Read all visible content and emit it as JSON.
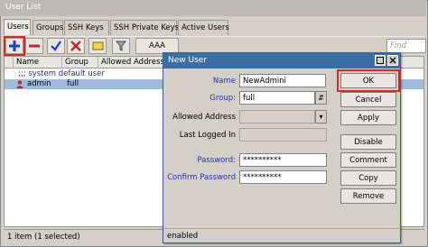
{
  "main_window": {
    "title": "User List",
    "tabs": [
      "Users",
      "Groups",
      "SSH Keys",
      "SSH Private Keys",
      "Active Users"
    ],
    "toolbar": {
      "aaa_label": "AAA",
      "find_placeholder": "Find"
    },
    "table": {
      "columns": [
        "Name",
        "Group",
        "Allowed Address"
      ],
      "comment": ";;; system default user",
      "rows": [
        {
          "name": "admin",
          "group": "full"
        }
      ]
    },
    "status": "1 item (1 selected)"
  },
  "dialog": {
    "title": "New User",
    "fields": {
      "name_label": "Name",
      "name_value": "NewAdmini",
      "group_label": "Group:",
      "group_value": "full",
      "allowed_label": "Allowed Address",
      "allowed_value": "",
      "last_logged_label": "Last Logged In",
      "last_logged_value": "",
      "password_label": "Password:",
      "password_value": "**********",
      "confirm_label": "Confirm Password",
      "confirm_value": "**********"
    },
    "buttons": [
      "OK",
      "Cancel",
      "Apply",
      "Disable",
      "Comment",
      "Copy",
      "Remove"
    ],
    "status": "enabled"
  },
  "colors": {
    "highlight": "#d32a2a",
    "title_active": "#3a6ea5",
    "label_blue": "#2432b8"
  }
}
